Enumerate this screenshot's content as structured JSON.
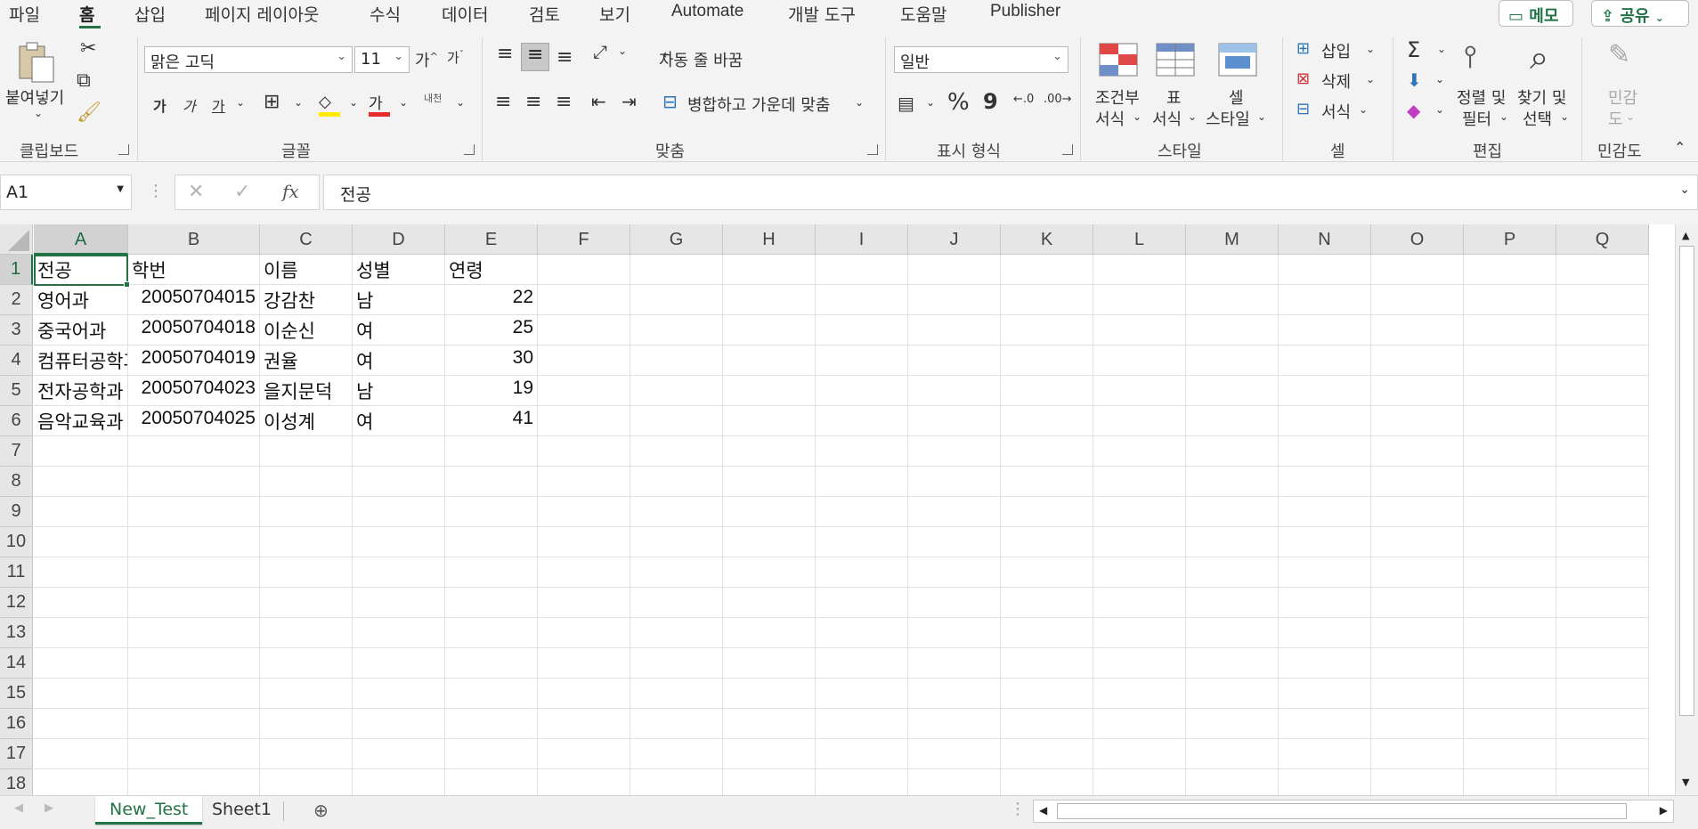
{
  "colors": {
    "accent": "#217346",
    "font_red": "#e52b2b",
    "highlight_yellow": "#ffea00"
  },
  "tabs": [
    {
      "label": "파일"
    },
    {
      "label": "홈"
    },
    {
      "label": "삽입"
    },
    {
      "label": "페이지 레이아웃"
    },
    {
      "label": "수식"
    },
    {
      "label": "데이터"
    },
    {
      "label": "검토"
    },
    {
      "label": "보기"
    },
    {
      "label": "Automate"
    },
    {
      "label": "개발 도구"
    },
    {
      "label": "도움말"
    },
    {
      "label": "Publisher"
    }
  ],
  "top_buttons": {
    "memo": "메모",
    "share": "공유"
  },
  "ribbon": {
    "clipboard": {
      "paste": "붙여넣기",
      "label": "클립보드"
    },
    "font": {
      "name": "맑은 고딕",
      "size": "11",
      "grow": "가",
      "shrink": "가",
      "bold": "가",
      "italic": "가",
      "underline": "가",
      "font_color": "가",
      "phonetic": "내천",
      "label": "글꼴"
    },
    "alignment": {
      "wrap": "자동 줄 바꿈",
      "merge": "병합하고 가운데 맞춤",
      "label": "맞춤"
    },
    "number": {
      "format": "일반",
      "percent": "%",
      "comma": "9",
      "label": "표시 형식"
    },
    "styles": {
      "conditional": [
        "조건부",
        "서식"
      ],
      "table": [
        "표",
        "서식"
      ],
      "cell": [
        "셀",
        "스타일"
      ],
      "label": "스타일"
    },
    "cells": {
      "insert": "삽입",
      "delete": "삭제",
      "format": "서식",
      "label": "셀"
    },
    "editing": {
      "sum": "Σ",
      "sort": [
        "정렬 및",
        "필터"
      ],
      "find": [
        "찾기 및",
        "선택"
      ],
      "label": "편집"
    },
    "sensitivity": {
      "button": [
        "민감",
        "도"
      ],
      "label": "민감도"
    }
  },
  "formula_bar": {
    "name_box": "A1",
    "fx": "fx",
    "content": "전공"
  },
  "grid": {
    "columns": [
      "A",
      "B",
      "C",
      "D",
      "E",
      "F",
      "G",
      "H",
      "I",
      "J",
      "K",
      "L",
      "M",
      "N",
      "O",
      "P",
      "Q"
    ],
    "rows": [
      "1",
      "2",
      "3",
      "4",
      "5",
      "6",
      "7",
      "8",
      "9",
      "10",
      "11",
      "12",
      "13",
      "14",
      "15",
      "16",
      "17",
      "18"
    ],
    "header_row": [
      "전공",
      "학번",
      "이름",
      "성별",
      "연령"
    ],
    "data": [
      [
        "영어과",
        "20050704015",
        "강감찬",
        "남",
        "22"
      ],
      [
        "중국어과",
        "20050704018",
        "이순신",
        "여",
        "25"
      ],
      [
        "컴퓨터공학과",
        "20050704019",
        "권율",
        "여",
        "30"
      ],
      [
        "전자공학과",
        "20050704023",
        "을지문덕",
        "남",
        "19"
      ],
      [
        "음악교육과",
        "20050704025",
        "이성계",
        "여",
        "41"
      ]
    ]
  },
  "sheets": [
    {
      "label": "New_Test",
      "active": true
    },
    {
      "label": "Sheet1",
      "active": false
    }
  ]
}
